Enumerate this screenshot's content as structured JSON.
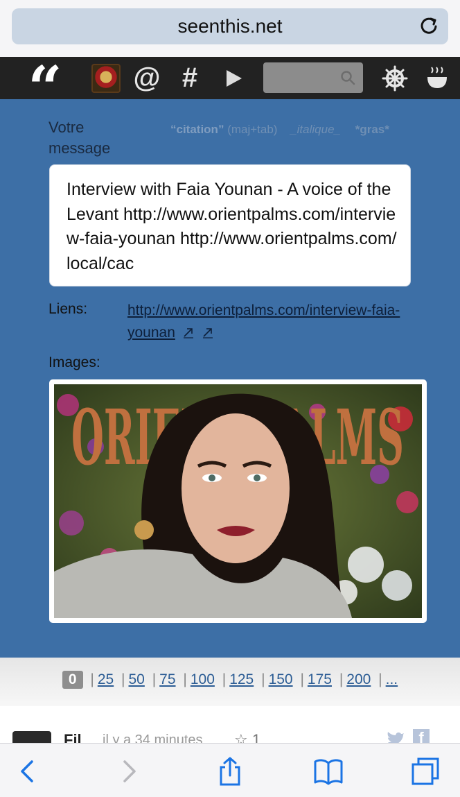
{
  "browser": {
    "url": "seenthis.net",
    "reload_icon": "reload-icon"
  },
  "toolbar": {
    "logo_glyph": "“",
    "at_glyph": "@",
    "hash_glyph": "#",
    "search_placeholder": ""
  },
  "compose": {
    "label": "Votre message",
    "hint_quote": "“citation”",
    "hint_quote_shortcut": "(maj+tab)",
    "hint_italic": "_italique_",
    "hint_bold": "*gras*",
    "message_text": "Interview with Faia Younan - A voice of the Levant http://www.orientpalms.com/interview-faia-younan http://www.orientpalms.com/local/cac",
    "links_label": "Liens:",
    "link_url": "http://www.orientpalms.com/interview-faia-younan",
    "images_label": "Images:",
    "image_overlay_text": "ORIENT PALMS"
  },
  "pagination": {
    "current": "0",
    "pages": [
      "25",
      "50",
      "75",
      "100",
      "125",
      "150",
      "175",
      "200"
    ],
    "more": "..."
  },
  "post": {
    "author": "Fil",
    "time": "il y a 34 minutes",
    "star_count": "☆ 1"
  },
  "colors": {
    "main_blue": "#3d6fa6",
    "toolbar_dark": "#222222",
    "link": "#2b5c94"
  }
}
